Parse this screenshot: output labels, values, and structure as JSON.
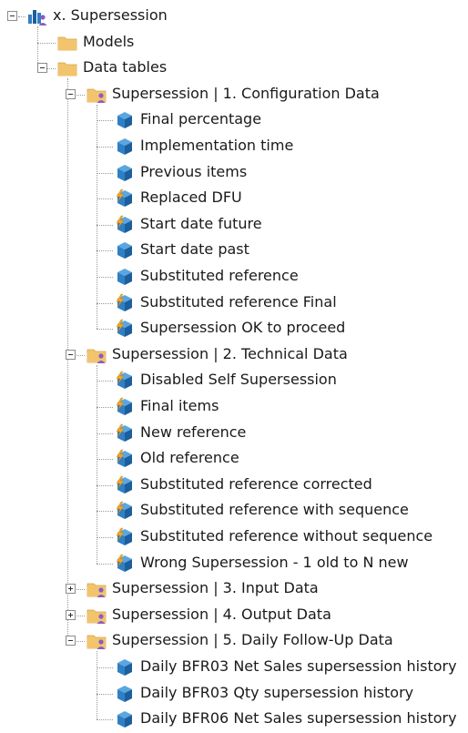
{
  "tree": {
    "nodes": [
      {
        "id": "root",
        "label": "x. Supersession",
        "level": 0,
        "icon": "model-root-icon",
        "expander": "minus"
      },
      {
        "id": "models",
        "label": "Models",
        "level": 1,
        "icon": "folder-icon",
        "expander": "none"
      },
      {
        "id": "datatables",
        "label": "Data tables",
        "level": 1,
        "icon": "folder-icon",
        "expander": "minus"
      },
      {
        "id": "g1",
        "label": "Supersession | 1. Configuration Data",
        "level": 2,
        "icon": "folder-user-icon",
        "expander": "minus"
      },
      {
        "id": "g1-1",
        "label": "Final percentage",
        "level": 3,
        "icon": "cube-icon",
        "expander": "none"
      },
      {
        "id": "g1-2",
        "label": "Implementation time",
        "level": 3,
        "icon": "cube-icon",
        "expander": "none"
      },
      {
        "id": "g1-3",
        "label": "Previous items",
        "level": 3,
        "icon": "cube-icon",
        "expander": "none"
      },
      {
        "id": "g1-4",
        "label": "Replaced DFU",
        "level": 3,
        "icon": "cube-bolt-icon",
        "expander": "none"
      },
      {
        "id": "g1-5",
        "label": "Start date future",
        "level": 3,
        "icon": "cube-bolt-icon",
        "expander": "none"
      },
      {
        "id": "g1-6",
        "label": "Start date past",
        "level": 3,
        "icon": "cube-icon",
        "expander": "none"
      },
      {
        "id": "g1-7",
        "label": "Substituted reference",
        "level": 3,
        "icon": "cube-icon",
        "expander": "none"
      },
      {
        "id": "g1-8",
        "label": "Substituted reference Final",
        "level": 3,
        "icon": "cube-bolt-icon",
        "expander": "none"
      },
      {
        "id": "g1-9",
        "label": "Supersession OK to proceed",
        "level": 3,
        "icon": "cube-bolt-icon",
        "expander": "none"
      },
      {
        "id": "g2",
        "label": "Supersession | 2. Technical Data",
        "level": 2,
        "icon": "folder-user-icon",
        "expander": "minus"
      },
      {
        "id": "g2-1",
        "label": "Disabled Self Supersession",
        "level": 3,
        "icon": "cube-bolt-icon",
        "expander": "none"
      },
      {
        "id": "g2-2",
        "label": "Final items",
        "level": 3,
        "icon": "cube-bolt-icon",
        "expander": "none"
      },
      {
        "id": "g2-3",
        "label": "New reference",
        "level": 3,
        "icon": "cube-bolt-icon",
        "expander": "none"
      },
      {
        "id": "g2-4",
        "label": "Old reference",
        "level": 3,
        "icon": "cube-bolt-icon",
        "expander": "none"
      },
      {
        "id": "g2-5",
        "label": "Substituted reference corrected",
        "level": 3,
        "icon": "cube-bolt-icon",
        "expander": "none"
      },
      {
        "id": "g2-6",
        "label": "Substituted reference with sequence",
        "level": 3,
        "icon": "cube-bolt-icon",
        "expander": "none"
      },
      {
        "id": "g2-7",
        "label": "Substituted reference without sequence",
        "level": 3,
        "icon": "cube-bolt-icon",
        "expander": "none"
      },
      {
        "id": "g2-8",
        "label": "Wrong Supersession - 1 old to N new",
        "level": 3,
        "icon": "cube-bolt-icon",
        "expander": "none"
      },
      {
        "id": "g3",
        "label": "Supersession | 3. Input Data",
        "level": 2,
        "icon": "folder-user-icon",
        "expander": "plus"
      },
      {
        "id": "g4",
        "label": "Supersession | 4. Output Data",
        "level": 2,
        "icon": "folder-user-icon",
        "expander": "plus"
      },
      {
        "id": "g5",
        "label": "Supersession | 5. Daily Follow-Up Data",
        "level": 2,
        "icon": "folder-user-icon",
        "expander": "minus"
      },
      {
        "id": "g5-1",
        "label": "Daily BFR03 Net Sales supersession history",
        "level": 3,
        "icon": "cube-icon",
        "expander": "none"
      },
      {
        "id": "g5-2",
        "label": "Daily BFR03 Qty supersession history",
        "level": 3,
        "icon": "cube-icon",
        "expander": "none"
      },
      {
        "id": "g5-3",
        "label": "Daily BFR06 Net Sales supersession history",
        "level": 3,
        "icon": "cube-icon",
        "expander": "none"
      }
    ]
  },
  "colors": {
    "folder": "#f2c46d",
    "cube": "#2f7fc4",
    "bolt": "#f6a623",
    "user": "#8a5cc4",
    "connector": "#9a9a9a"
  }
}
